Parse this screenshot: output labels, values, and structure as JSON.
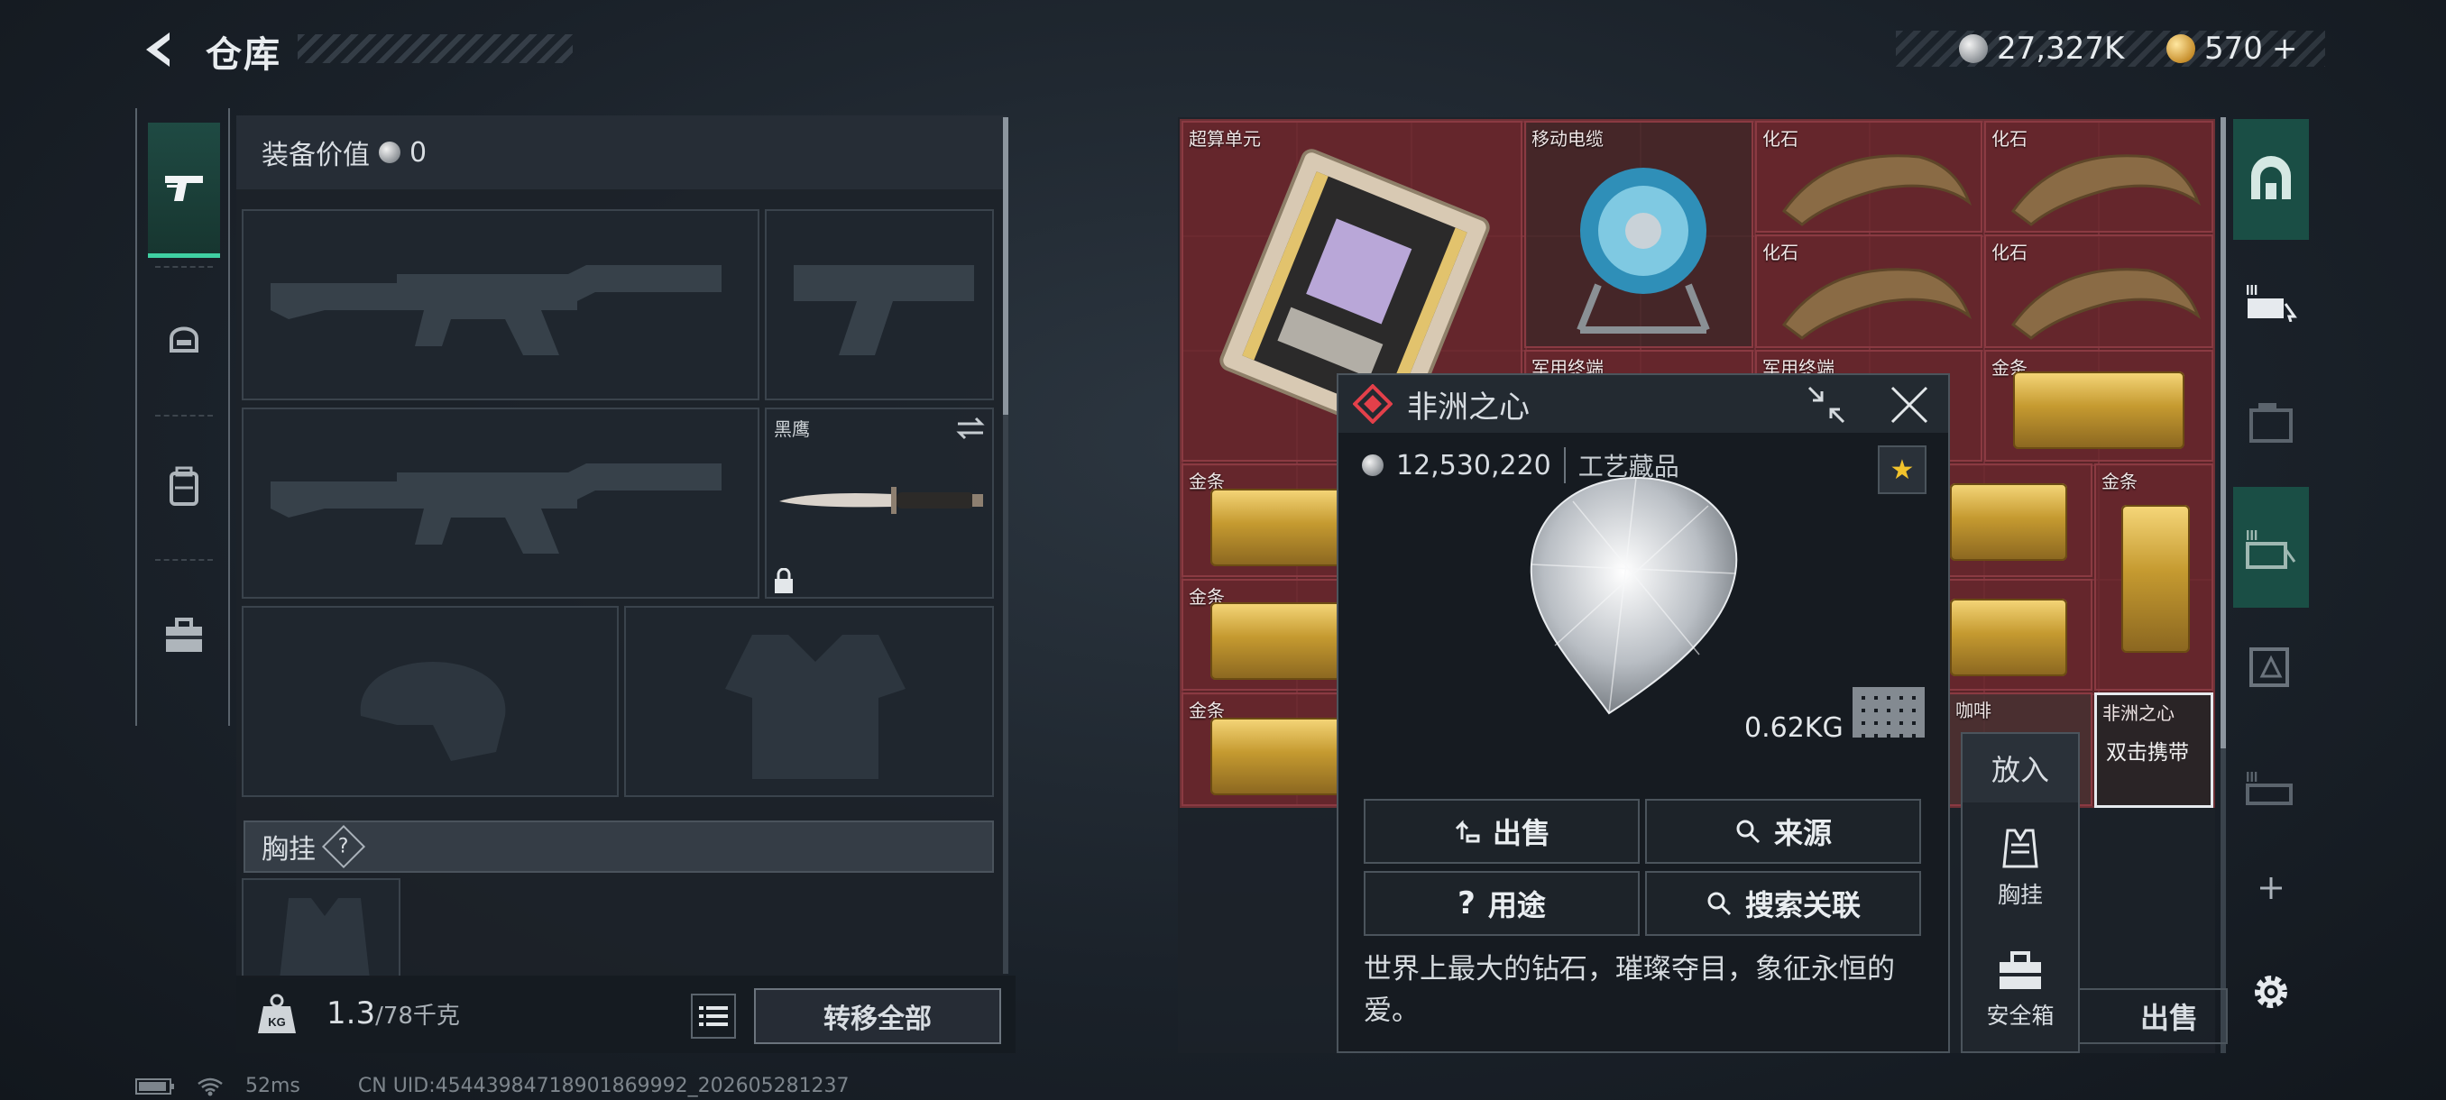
{
  "header": {
    "title": "仓库"
  },
  "currency": {
    "silver": "27,327K",
    "gold": "570",
    "gold_plus": "+"
  },
  "equipment": {
    "value_label": "装备价值",
    "value": "0",
    "melee_label": "黑鹰",
    "chest_label": "胸挂",
    "chest_help": "?"
  },
  "weight": {
    "current": "1.3",
    "max": "/78千克",
    "kg_icon_text": "KG"
  },
  "transfer_all": "转移全部",
  "status": {
    "ping": "52ms",
    "uid": "CN UID:4544398471890186999​2_202605281237"
  },
  "storage": {
    "labels": {
      "compute": "超算单元",
      "cable": "移动电缆",
      "fossil": "化石",
      "comm": "军用终端",
      "gold": "金条",
      "heart": "非洲之心",
      "coffee": "咖啡"
    },
    "heart_hint": "双击携带"
  },
  "popup": {
    "name": "非洲之心",
    "price": "12,530,220",
    "category": "工艺藏品",
    "weight": "0.62KG",
    "buttons": {
      "sell": "出售",
      "source": "来源",
      "usage": "用途",
      "search": "搜索关联"
    },
    "description": "世界上最大的钻石，璀璨夺目，象征永恒的爱。"
  },
  "context_menu": {
    "put": "放入",
    "chest": "胸挂",
    "safe": "安全箱"
  },
  "sell_button": "出售",
  "colors": {
    "accent": "#3fd0a2",
    "storage_bg": "#5a2428",
    "star": "#f2c32c"
  }
}
